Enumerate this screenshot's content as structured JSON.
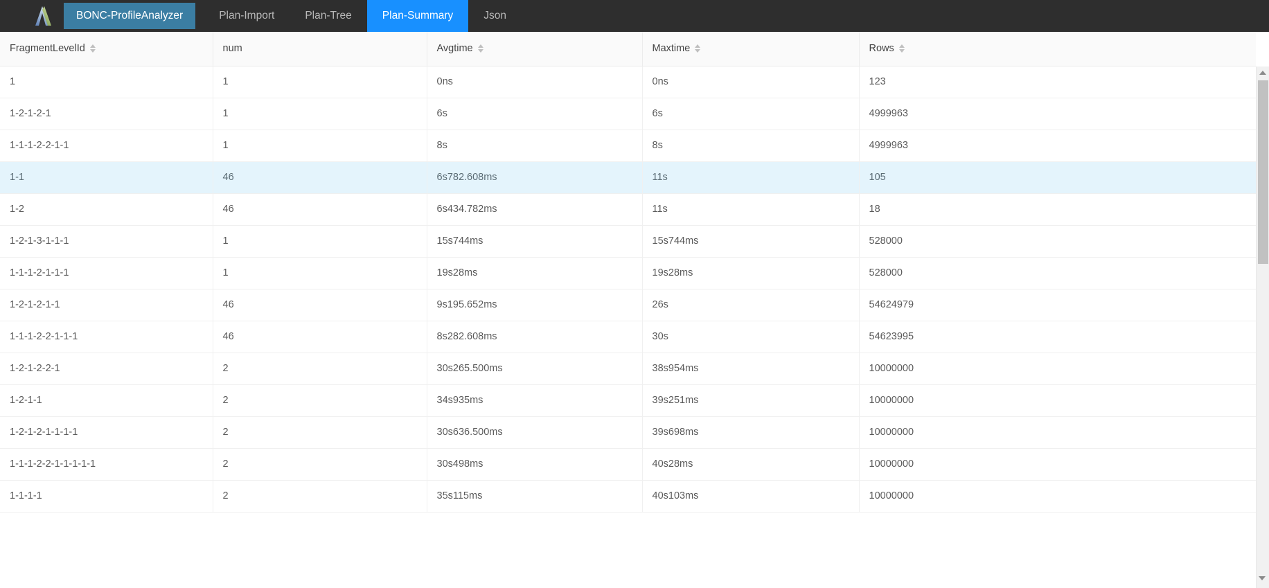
{
  "navbar": {
    "logo_icon": "bonc-arrow-logo-icon",
    "brand_label": "BONC-ProfileAnalyzer",
    "tabs": [
      {
        "label": "Plan-Import",
        "active": false
      },
      {
        "label": "Plan-Tree",
        "active": false
      },
      {
        "label": "Plan-Summary",
        "active": true
      },
      {
        "label": "Json",
        "active": false
      }
    ],
    "background_color": "#2e2e2e",
    "brand_color": "#3b7ea3",
    "active_tab_color": "#1890ff"
  },
  "table": {
    "columns": [
      {
        "key": "fragmentLevelId",
        "label": "FragmentLevelId",
        "sortable": true
      },
      {
        "key": "num",
        "label": "num",
        "sortable": false
      },
      {
        "key": "avgtime",
        "label": "Avgtime",
        "sortable": true
      },
      {
        "key": "maxtime",
        "label": "Maxtime",
        "sortable": true
      },
      {
        "key": "rows",
        "label": "Rows",
        "sortable": true
      }
    ],
    "rows": [
      {
        "fragmentLevelId": "1",
        "num": "1",
        "avgtime": "0ns",
        "maxtime": "0ns",
        "rows": "123",
        "highlighted": false
      },
      {
        "fragmentLevelId": "1-2-1-2-1",
        "num": "1",
        "avgtime": "6s",
        "maxtime": "6s",
        "rows": "4999963",
        "highlighted": false
      },
      {
        "fragmentLevelId": "1-1-1-2-2-1-1",
        "num": "1",
        "avgtime": "8s",
        "maxtime": "8s",
        "rows": "4999963",
        "highlighted": false
      },
      {
        "fragmentLevelId": "1-1",
        "num": "46",
        "avgtime": "6s782.608ms",
        "maxtime": "11s",
        "rows": "105",
        "highlighted": true
      },
      {
        "fragmentLevelId": "1-2",
        "num": "46",
        "avgtime": "6s434.782ms",
        "maxtime": "11s",
        "rows": "18",
        "highlighted": false
      },
      {
        "fragmentLevelId": "1-2-1-3-1-1-1",
        "num": "1",
        "avgtime": "15s744ms",
        "maxtime": "15s744ms",
        "rows": "528000",
        "highlighted": false
      },
      {
        "fragmentLevelId": "1-1-1-2-1-1-1",
        "num": "1",
        "avgtime": "19s28ms",
        "maxtime": "19s28ms",
        "rows": "528000",
        "highlighted": false
      },
      {
        "fragmentLevelId": "1-2-1-2-1-1",
        "num": "46",
        "avgtime": "9s195.652ms",
        "maxtime": "26s",
        "rows": "54624979",
        "highlighted": false
      },
      {
        "fragmentLevelId": "1-1-1-2-2-1-1-1",
        "num": "46",
        "avgtime": "8s282.608ms",
        "maxtime": "30s",
        "rows": "54623995",
        "highlighted": false
      },
      {
        "fragmentLevelId": "1-2-1-2-2-1",
        "num": "2",
        "avgtime": "30s265.500ms",
        "maxtime": "38s954ms",
        "rows": "10000000",
        "highlighted": false
      },
      {
        "fragmentLevelId": "1-2-1-1",
        "num": "2",
        "avgtime": "34s935ms",
        "maxtime": "39s251ms",
        "rows": "10000000",
        "highlighted": false
      },
      {
        "fragmentLevelId": "1-2-1-2-1-1-1-1",
        "num": "2",
        "avgtime": "30s636.500ms",
        "maxtime": "39s698ms",
        "rows": "10000000",
        "highlighted": false
      },
      {
        "fragmentLevelId": "1-1-1-2-2-1-1-1-1-1",
        "num": "2",
        "avgtime": "30s498ms",
        "maxtime": "40s28ms",
        "rows": "10000000",
        "highlighted": false
      },
      {
        "fragmentLevelId": "1-1-1-1",
        "num": "2",
        "avgtime": "35s115ms",
        "maxtime": "40s103ms",
        "rows": "10000000",
        "highlighted": false
      }
    ],
    "highlight_color": "#e4f4fc",
    "header_background": "#fafafa"
  },
  "scrollbars": {
    "table_scroll_up_icon": "caret-up-icon",
    "page_scroll_down_icon": "caret-down-icon"
  }
}
